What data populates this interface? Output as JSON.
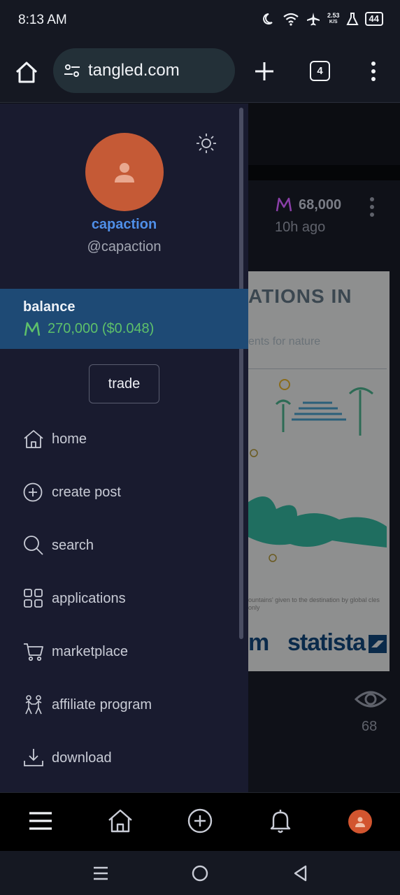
{
  "status_bar": {
    "time": "8:13 AM",
    "net_speed_top": "2.53",
    "net_speed_unit": "K/S",
    "battery": "44"
  },
  "browser": {
    "url": "tangled.com",
    "tab_count": "4"
  },
  "background_post": {
    "amount": "68,000",
    "time_ago": "10h ago",
    "image_title": "ATIONS IN",
    "image_subtitle": "ents for nature",
    "image_caption": "ountains' given to the destination by global\ncles only",
    "image_brand_left": "m",
    "image_brand": "statista",
    "views": "68"
  },
  "drawer": {
    "username": "capaction",
    "handle": "@capaction",
    "balance_label": "balance",
    "balance_value": "270,000 ($0.048)",
    "trade_label": "trade",
    "menu": [
      {
        "label": "home",
        "icon": "home-icon"
      },
      {
        "label": "create post",
        "icon": "plus-circle-icon"
      },
      {
        "label": "search",
        "icon": "search-icon"
      },
      {
        "label": "applications",
        "icon": "grid-icon"
      },
      {
        "label": "marketplace",
        "icon": "cart-icon"
      },
      {
        "label": "affiliate program",
        "icon": "people-icon"
      },
      {
        "label": "download",
        "icon": "download-icon"
      }
    ]
  },
  "colors": {
    "drawer_bg": "#191b2f",
    "balance_bg": "#1e4a75",
    "balance_green": "#5ec06a",
    "username_blue": "#4f8fe8",
    "avatar_orange": "#c55a36"
  }
}
